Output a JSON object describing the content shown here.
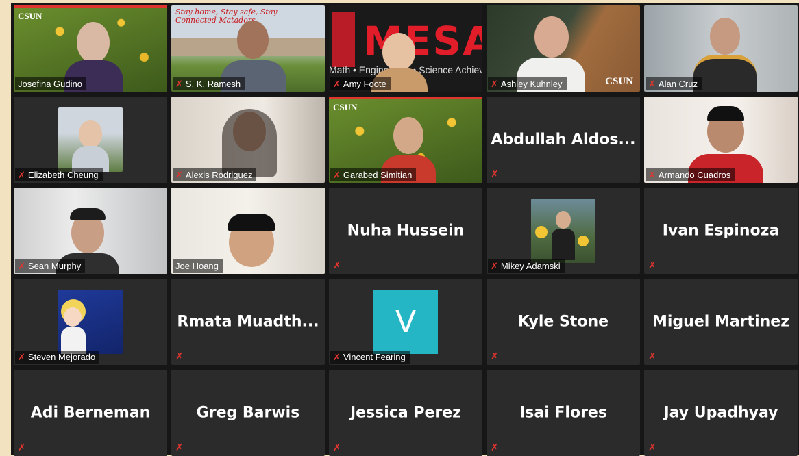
{
  "participants": [
    {
      "name": "Josefina Gudino",
      "kind": "video"
    },
    {
      "name": "S. K. Ramesh",
      "kind": "video",
      "banner": "Stay home, Stay safe, Stay Connected Matadors"
    },
    {
      "name": "Amy Foote",
      "kind": "video",
      "banner": "MESA",
      "sub": "Math • Engineering • Science Achievement"
    },
    {
      "name": "Ashley Kuhnley",
      "kind": "video",
      "badge": "CSUN"
    },
    {
      "name": "Alan Cruz",
      "kind": "video"
    },
    {
      "name": "Elizabeth Cheung",
      "kind": "photo"
    },
    {
      "name": "Alexis Rodriguez",
      "kind": "video"
    },
    {
      "name": "Garabed Simitian",
      "kind": "video",
      "badge": "CSUN"
    },
    {
      "name": "Abdullah  Aldos...",
      "kind": "name"
    },
    {
      "name": "Armando Cuadros",
      "kind": "video"
    },
    {
      "name": "Sean Murphy",
      "kind": "video"
    },
    {
      "name": "Joe Hoang",
      "kind": "video",
      "active": true
    },
    {
      "name": "Nuha Hussein",
      "kind": "name"
    },
    {
      "name": "Mikey Adamski",
      "kind": "photo"
    },
    {
      "name": "Ivan Espinoza",
      "kind": "name"
    },
    {
      "name": "Steven Mejorado",
      "kind": "photo"
    },
    {
      "name": "Rmata  Muadth...",
      "kind": "name"
    },
    {
      "name": "Vincent Fearing",
      "kind": "initial",
      "initial": "V"
    },
    {
      "name": "Kyle Stone",
      "kind": "name"
    },
    {
      "name": "Miguel Martinez",
      "kind": "name"
    },
    {
      "name": "Adi Berneman",
      "kind": "name"
    },
    {
      "name": "Greg Barwis",
      "kind": "name"
    },
    {
      "name": "Jessica Perez",
      "kind": "name"
    },
    {
      "name": "Isai Flores",
      "kind": "name"
    },
    {
      "name": "Jay Upadhyay",
      "kind": "name"
    }
  ],
  "icons": {
    "muted": "mic-muted-icon"
  },
  "colors": {
    "muted": "#e0352f",
    "active_speaker": "#d7e36a",
    "tile": "#2b2b2b",
    "initial_bg": "#24b6c4"
  }
}
